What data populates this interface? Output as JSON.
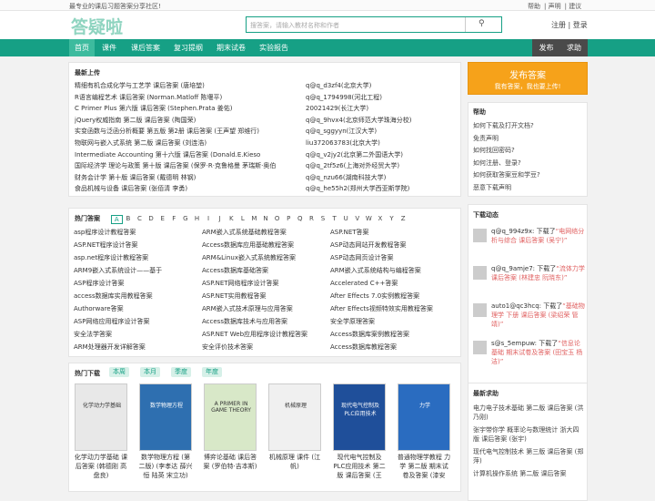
{
  "topbar": {
    "slogan": "最专业的课后习题答案分享社区!",
    "links": [
      "帮助",
      "声明",
      "建议"
    ]
  },
  "header": {
    "logo": "答疑啦",
    "search_placeholder": "搜答案，请输入教材名称和作者",
    "auth": "注册 | 登录"
  },
  "nav": {
    "items": [
      "首页",
      "课件",
      "课后答案",
      "复习提纲",
      "期末试卷",
      "实验报告"
    ],
    "right": [
      "发布",
      "求助"
    ]
  },
  "latest": {
    "title": "最新上传",
    "rows": [
      {
        "book": "精细有机合成化学与工艺学 课后答案 (唐培堃)",
        "user": "q@q_d3zf4(北京大学)"
      },
      {
        "book": "R语言编程艺术 课后答案 (Norman.Matloff 陈堰平)",
        "user": "q@q_1794998(河北工程)"
      },
      {
        "book": "C Primer Plus 第六版 课后答案 (Stephen.Prata 姜佑)",
        "user": "20021429(长江大学)"
      },
      {
        "book": "jQuery权威指南 第二版 课后答案 (陶国荣)",
        "user": "q@q_9hvx4(北京师范大学珠海分校)"
      },
      {
        "book": "实变函数与泛函分析概要 第五版 第2册 课后答案 (王声望 郑维行)",
        "user": "q@q_sggyyn(江汉大学)"
      },
      {
        "book": "物联网与嵌入式系统 第二版 课后答案 (刘连浩)",
        "user": "liu372063783(北京大学)"
      },
      {
        "book": "Intermediate Accounting 第十六版 课后答案 (Donald.E.Kieso",
        "user": "q@q_v2jy2(北京第二外国语大学)"
      },
      {
        "book": "国际经济学 理论与政策 第十版 课后答案 (保罗·R·克鲁格曼 茅瑞斯·奥伯",
        "user": "q@q_2tf5z6(上海对外经贸大学)"
      },
      {
        "book": "财务会计学 第十版 课后答案 (戴德明 林钢)",
        "user": "q@q_nzu66(湖南科技大学)"
      },
      {
        "book": "食品机械与设备 课后答案 (张佰清 李勇)",
        "user": "q@q_he55h2(郑州大学西亚斯学院)"
      }
    ]
  },
  "hot": {
    "title": "热门答案",
    "letters": [
      "A",
      "B",
      "C",
      "D",
      "E",
      "F",
      "G",
      "H",
      "I",
      "J",
      "K",
      "L",
      "M",
      "N",
      "O",
      "P",
      "Q",
      "R",
      "S",
      "T",
      "U",
      "V",
      "W",
      "X",
      "Y",
      "Z"
    ],
    "selected": "A",
    "col1": [
      "asp程序设计教程答案",
      "ASP.NET程序设计答案",
      "asp.net程序设计教程答案",
      "ARM9嵌入式系统设计——基于",
      "ASP程序设计答案",
      "access数据库实用教程答案",
      "Authorware答案",
      "ASP网络应用程序设计答案",
      "安全法学答案",
      "ARM处理器开发详解答案"
    ],
    "col2": [
      "ARM嵌入式系统基础教程答案",
      "Access数据库应用基础教程答案",
      "ARM&Linux嵌入式系统教程答案",
      "Access数据库基础答案",
      "ASP.NET网络程序设计答案",
      "ASP.NET实用教程答案",
      "ARM嵌入式技术原理与应用答案",
      "Access数据库技术与应用答案",
      "ASP.NET Web应用程序设计教程答案",
      "安全评价技术答案"
    ],
    "col3": [
      "ASP.NET答案",
      "ASP动态网站开发教程答案",
      "ASP动态网页设计答案",
      "ARM嵌入式系统结构与编程答案",
      "Accelerated C++答案",
      "After Effects 7.0实例教程答案",
      "After Effects视频特效实用教程答案",
      "安全学原理答案",
      "Access数据库案例教程答案",
      "Access数据库教程答案"
    ]
  },
  "downloads": {
    "title": "热门下载",
    "tabs": [
      "本周",
      "本月",
      "季度",
      "年度"
    ],
    "books": [
      {
        "caption": "化学动力学基础 课后答案 (韩德刚 高盘良)",
        "cover_title": "化学动力学基础",
        "color": "#e8e8e8"
      },
      {
        "caption": "数学物理方程 (第二版) (李孝达 薛兴恒 陆英 宋立功)",
        "cover_title": "数学物理方程",
        "color": "#2e6fb0"
      },
      {
        "caption": "博弈论基础 课后答案 (罗伯特·吉本斯)",
        "cover_title": "A PRIMER IN GAME THEORY",
        "color": "#d8e8c8"
      },
      {
        "caption": "机械原理 课件 (江帆)",
        "cover_title": "机械原理",
        "color": "#f0f0f0"
      },
      {
        "caption": "现代电气控制及PLC应用技术 第二版 课后答案 (王",
        "cover_title": "现代电气控制及PLC应用技术",
        "color": "#1f4f9a"
      },
      {
        "caption": "普通物理学教程 力学 第二版 期末试卷及答案 (漆安",
        "cover_title": "力学",
        "color": "#2a6cc0"
      }
    ]
  },
  "side": {
    "post": {
      "title": "发布答案",
      "sub": "我有答案，我也要上传!"
    },
    "help": {
      "title": "帮助",
      "items": [
        "如何下载及打开文档?",
        "免责声明",
        "如何找回密码?",
        "如何注册、登录?",
        "如何获取答案豆和学豆?",
        "恶意下载声明"
      ]
    },
    "dynamics": {
      "title": "下载动态",
      "items": [
        {
          "user": "q@q_994z9x:",
          "action": " 下载了",
          "book": "“电网络分析与综合 课后答案 (吴宁)”"
        },
        {
          "user": "q@q_9amje7:",
          "action": " 下载了",
          "book": "“流体力学 课后答案 (林建忠 阮晓东)”"
        },
        {
          "user": "auto1@qc3hcq:",
          "action": " 下载了",
          "book": "“基础物理学 下册 课后答案 (梁绍荣 管靖)”"
        },
        {
          "user": "s@s_5empuw:",
          "action": " 下载了",
          "book": "“信息论基础 期末试卷及答案 (田宝玉 杨洁)”"
        }
      ]
    },
    "requests": {
      "title": "最新求助",
      "items": [
        "电力电子技术基础 第二版 课后答案 (洪乃刚)",
        "张宇带你学 概率论与数理统计 浙大四版 课后答案 (张宇)",
        "现代电气控制技术 第三版 课后答案 (郑萍)",
        "计算机操作系统 第二版 课后答案"
      ]
    }
  },
  "colors": {
    "brand": "#16a085",
    "accent": "#f6a21a",
    "link_red": "#e06060"
  }
}
